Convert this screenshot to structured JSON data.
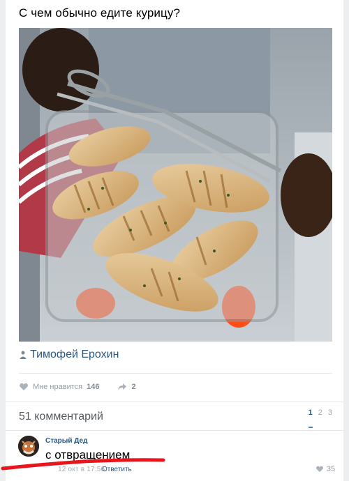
{
  "post": {
    "text": "С чем обычно едите курицу?",
    "shared_author": "Тимофей Ерохин"
  },
  "actions": {
    "like_label": "Мне нравится",
    "like_count": "146",
    "share_count": "2"
  },
  "comments": {
    "header": "51 комментарий",
    "pages": [
      "1",
      "2",
      "3"
    ],
    "items": [
      {
        "author": "Старый Дед",
        "text": "с отвращением",
        "date": "12 окт в 17:56",
        "reply_label": "Ответить",
        "likes": "35"
      }
    ]
  },
  "colors": {
    "link": "#2a5885",
    "muted": "#939ba6",
    "underline": "#e8161c"
  }
}
